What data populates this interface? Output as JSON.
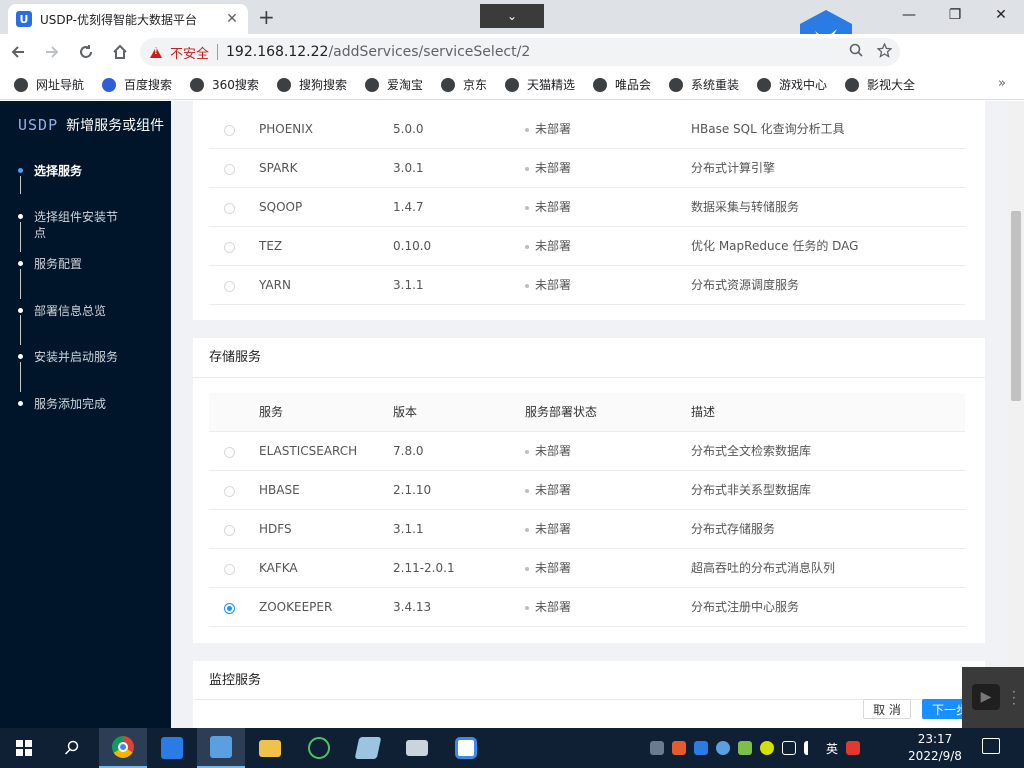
{
  "browser": {
    "tab_title": "USDP-优刻得智能大数据平台",
    "tab_favicon": "U",
    "tab_close": "✕",
    "new_tab": "+",
    "dropdown": "⌄",
    "window": {
      "minimize": "—",
      "restore": "❐",
      "close": "✕"
    },
    "insecure_label": "不安全",
    "url_host": "192.168.12.22",
    "url_path": "/addServices/serviceSelect/2",
    "bookmarks": [
      "网址导航",
      "百度搜索",
      "360搜索",
      "搜狗搜索",
      "爱淘宝",
      "京东",
      "天猫精选",
      "唯品会",
      "系统重装",
      "游戏中心",
      "影视大全"
    ],
    "bookmarks_more": "»"
  },
  "sidebar": {
    "logo": "USDP",
    "title": "新增服务或组件",
    "steps": [
      {
        "label": "选择服务",
        "active": true
      },
      {
        "label": "选择组件安装节点",
        "active": false
      },
      {
        "label": "服务配置",
        "active": false
      },
      {
        "label": "部署信息总览",
        "active": false
      },
      {
        "label": "安装并启动服务",
        "active": false
      },
      {
        "label": "服务添加完成",
        "active": false
      }
    ]
  },
  "compute_rows": [
    {
      "name": "PHOENIX",
      "version": "5.0.0",
      "status": "未部署",
      "desc": "HBase SQL 化查询分析工具",
      "selected": false
    },
    {
      "name": "SPARK",
      "version": "3.0.1",
      "status": "未部署",
      "desc": "分布式计算引擎",
      "selected": false
    },
    {
      "name": "SQOOP",
      "version": "1.4.7",
      "status": "未部署",
      "desc": "数据采集与转储服务",
      "selected": false
    },
    {
      "name": "TEZ",
      "version": "0.10.0",
      "status": "未部署",
      "desc": "优化 MapReduce 任务的 DAG",
      "selected": false
    },
    {
      "name": "YARN",
      "version": "3.1.1",
      "status": "未部署",
      "desc": "分布式资源调度服务",
      "selected": false
    }
  ],
  "storage": {
    "title": "存储服务",
    "headers": {
      "name": "服务",
      "version": "版本",
      "status": "服务部署状态",
      "desc": "描述"
    },
    "rows": [
      {
        "name": "ELASTICSEARCH",
        "version": "7.8.0",
        "status": "未部署",
        "desc": "分布式全文检索数据库",
        "selected": false
      },
      {
        "name": "HBASE",
        "version": "2.1.10",
        "status": "未部署",
        "desc": "分布式非关系型数据库",
        "selected": false
      },
      {
        "name": "HDFS",
        "version": "3.1.1",
        "status": "未部署",
        "desc": "分布式存储服务",
        "selected": false
      },
      {
        "name": "KAFKA",
        "version": "2.11-2.0.1",
        "status": "未部署",
        "desc": "超高吞吐的分布式消息队列",
        "selected": false
      },
      {
        "name": "ZOOKEEPER",
        "version": "3.4.13",
        "status": "未部署",
        "desc": "分布式注册中心服务",
        "selected": true
      }
    ]
  },
  "monitor": {
    "title": "监控服务"
  },
  "footer": {
    "cancel": "取 消",
    "next": "下一步"
  },
  "taskbar": {
    "ime": "英",
    "time": "23:17",
    "date": "2022/9/8"
  }
}
